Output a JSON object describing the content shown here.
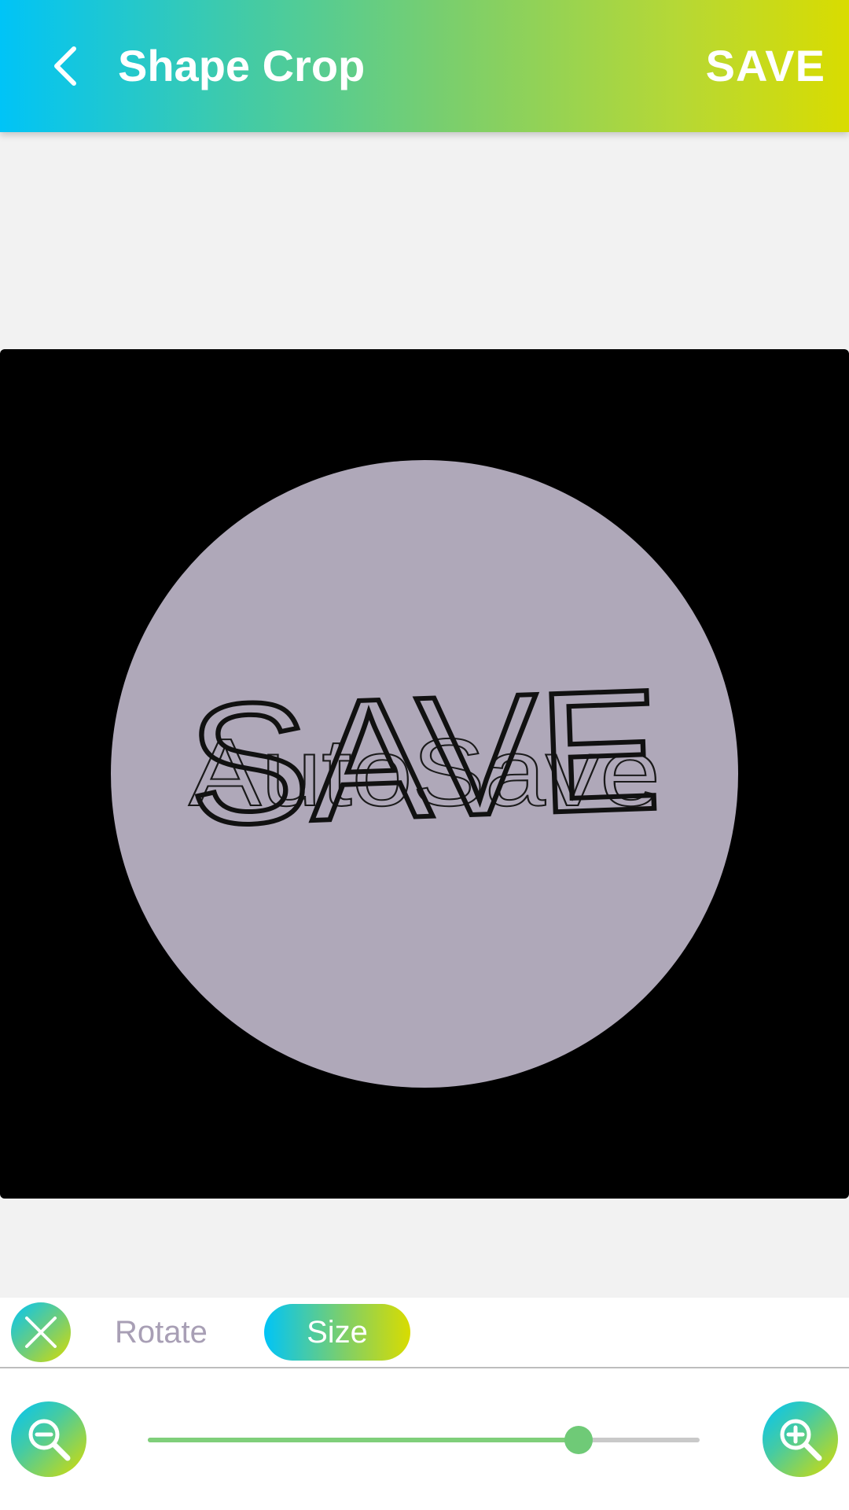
{
  "header": {
    "title": "Shape Crop",
    "save_label": "SAVE",
    "back_icon": "chevron-left-icon"
  },
  "canvas": {
    "shape": "circle",
    "image_text_primary": "SAVE",
    "image_text_secondary": "AutoSave",
    "background_color": "#000000",
    "shape_color": "#afa8b9"
  },
  "toolbar": {
    "close_icon": "close-icon",
    "tabs": [
      {
        "label": "Rotate",
        "selected": false
      },
      {
        "label": "Size",
        "selected": true
      }
    ]
  },
  "zoom": {
    "zoom_out_icon": "zoom-out-icon",
    "zoom_in_icon": "zoom-in-icon",
    "level_fraction": 0.78
  },
  "colors": {
    "gradient_start": "#00c4f7",
    "gradient_end": "#d9dc00",
    "slider_active": "#7fcf7a",
    "inactive_tab_text": "#a89fb5"
  }
}
